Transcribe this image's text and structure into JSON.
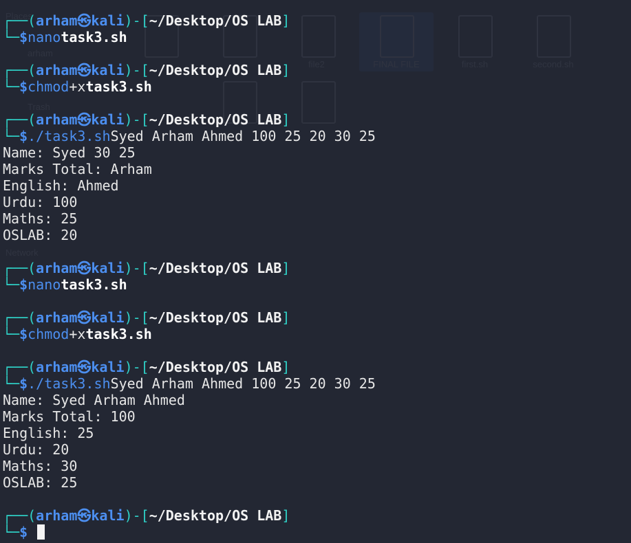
{
  "prompt": {
    "user": "arham",
    "separator_icon": "kali-dragon-icon",
    "host": "kali",
    "path": "~/Desktop/OS LAB",
    "symbol": "$"
  },
  "sessions": [
    {
      "command": "nano",
      "args": "task3.sh",
      "output": []
    },
    {
      "command": "chmod",
      "args_plain": "+x",
      "args": "task3.sh",
      "output": []
    },
    {
      "command": "./task3.sh",
      "args_plain": "Syed Arham Ahmed 100 25 20 30 25",
      "output": [
        "Name: Syed 30 25",
        "Marks Total: Arham",
        "English: Ahmed",
        "Urdu: 100",
        "Maths: 25",
        "OSLAB: 20"
      ]
    },
    {
      "command": "nano",
      "args": "task3.sh",
      "output": []
    },
    {
      "command": "chmod",
      "args_plain": "+x",
      "args": "task3.sh",
      "output": []
    },
    {
      "command": "./task3.sh",
      "args_plain": "Syed Arham Ahmed 100 25 20 30 25",
      "output": [
        "Name: Syed Arham Ahmed",
        "Marks Total: 100",
        "English: 25",
        "Urdu: 20",
        "Maths: 30",
        "OSLAB: 25"
      ]
    }
  ],
  "background_desktop": {
    "files": [
      "file2",
      "FINAL FILE",
      "first.sh",
      "second.sh"
    ],
    "sidebar": [
      "Places",
      "arham",
      "Trash",
      "Network"
    ]
  },
  "colors": {
    "background": "#232733",
    "frame": "#2fd2c8",
    "prompt_blue": "#4c8ff0",
    "text": "#e6e6e6"
  }
}
